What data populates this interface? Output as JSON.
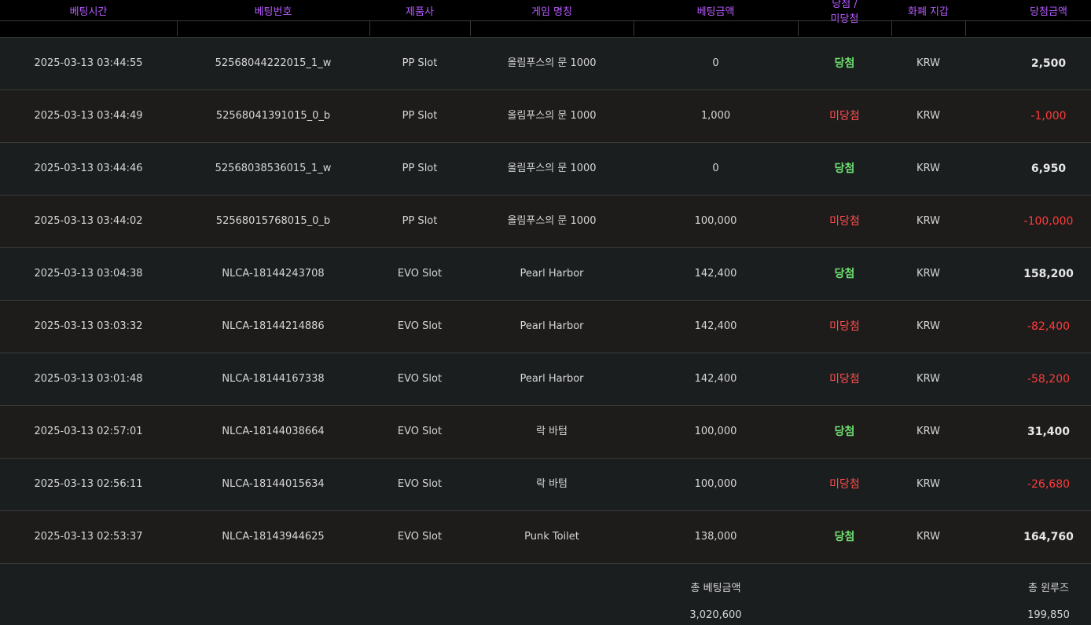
{
  "headers": {
    "bet_time": "베팅시간",
    "bet_number": "베팅번호",
    "provider": "제품사",
    "game_name": "게임 명칭",
    "bet_amount": "베팅금액",
    "result_line1": "당첨 /",
    "result_line2": "미당첨",
    "currency": "화폐 지갑",
    "win_amount": "당첨금액"
  },
  "rows": [
    {
      "time": "2025-03-13 03:44:55",
      "id": "52568044222015_1_w",
      "provider": "PP Slot",
      "game": "올림푸스의 문 1000",
      "bet": "0",
      "result": "당첨",
      "currency": "KRW",
      "amount": "2,500"
    },
    {
      "time": "2025-03-13 03:44:49",
      "id": "52568041391015_0_b",
      "provider": "PP Slot",
      "game": "올림푸스의 문 1000",
      "bet": "1,000",
      "result": "미당첨",
      "currency": "KRW",
      "amount": "-1,000"
    },
    {
      "time": "2025-03-13 03:44:46",
      "id": "52568038536015_1_w",
      "provider": "PP Slot",
      "game": "올림푸스의 문 1000",
      "bet": "0",
      "result": "당첨",
      "currency": "KRW",
      "amount": "6,950"
    },
    {
      "time": "2025-03-13 03:44:02",
      "id": "52568015768015_0_b",
      "provider": "PP Slot",
      "game": "올림푸스의 문 1000",
      "bet": "100,000",
      "result": "미당첨",
      "currency": "KRW",
      "amount": "-100,000"
    },
    {
      "time": "2025-03-13 03:04:38",
      "id": "NLCA-18144243708",
      "provider": "EVO Slot",
      "game": "Pearl Harbor",
      "bet": "142,400",
      "result": "당첨",
      "currency": "KRW",
      "amount": "158,200"
    },
    {
      "time": "2025-03-13 03:03:32",
      "id": "NLCA-18144214886",
      "provider": "EVO Slot",
      "game": "Pearl Harbor",
      "bet": "142,400",
      "result": "미당첨",
      "currency": "KRW",
      "amount": "-82,400"
    },
    {
      "time": "2025-03-13 03:01:48",
      "id": "NLCA-18144167338",
      "provider": "EVO Slot",
      "game": "Pearl Harbor",
      "bet": "142,400",
      "result": "미당첨",
      "currency": "KRW",
      "amount": "-58,200"
    },
    {
      "time": "2025-03-13 02:57:01",
      "id": "NLCA-18144038664",
      "provider": "EVO Slot",
      "game": "락 바텀",
      "bet": "100,000",
      "result": "당첨",
      "currency": "KRW",
      "amount": "31,400"
    },
    {
      "time": "2025-03-13 02:56:11",
      "id": "NLCA-18144015634",
      "provider": "EVO Slot",
      "game": "락 바텀",
      "bet": "100,000",
      "result": "미당첨",
      "currency": "KRW",
      "amount": "-26,680"
    },
    {
      "time": "2025-03-13 02:53:37",
      "id": "NLCA-18143944625",
      "provider": "EVO Slot",
      "game": "Punk Toilet",
      "bet": "138,000",
      "result": "당첨",
      "currency": "KRW",
      "amount": "164,760"
    }
  ],
  "footer": {
    "total_bet_label": "총 베팅금액",
    "total_bet_value": "3,020,600",
    "total_winloss_label": "총 윈루즈",
    "total_winloss_value": "199,850"
  },
  "colors": {
    "header_text": "#b85bff",
    "win": "#6fe06f",
    "lose": "#ff4d4d",
    "negative_amount": "#ff3b3b"
  }
}
